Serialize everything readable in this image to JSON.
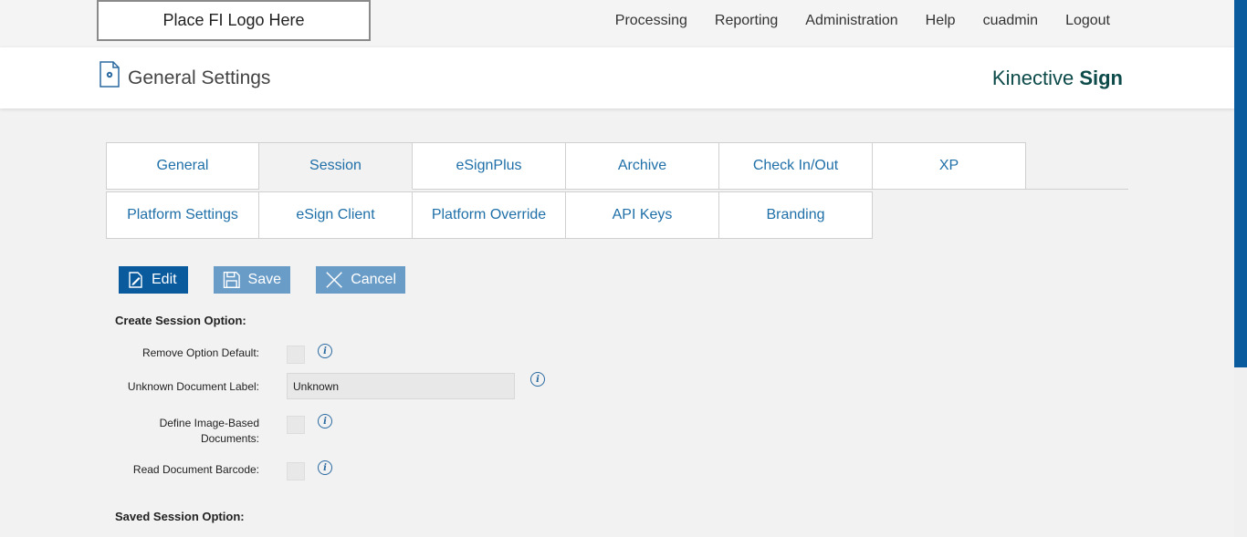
{
  "topbar": {
    "logo_placeholder": "Place FI Logo Here",
    "nav": [
      "Processing",
      "Reporting",
      "Administration",
      "Help",
      "cuadmin",
      "Logout"
    ]
  },
  "header": {
    "title": "General Settings",
    "brand_light": "Kinective",
    "brand_bold": "Sign"
  },
  "tabs": {
    "row1": [
      "General",
      "Session",
      "eSignPlus",
      "Archive",
      "Check In/Out",
      "XP"
    ],
    "row2": [
      "Platform Settings",
      "eSign Client",
      "Platform Override",
      "API Keys",
      "Branding"
    ],
    "active": "Session"
  },
  "toolbar": {
    "edit_label": "Edit",
    "save_label": "Save",
    "cancel_label": "Cancel"
  },
  "form": {
    "create_section_title": "Create Session Option:",
    "remove_option_default_label": "Remove Option Default:",
    "unknown_document_label_label": "Unknown Document Label:",
    "unknown_document_label_value": "Unknown",
    "define_image_based_label_line1": "Define Image-Based",
    "define_image_based_label_line2": "Documents:",
    "read_document_barcode_label": "Read Document Barcode:",
    "saved_section_title": "Saved Session Option:",
    "info_glyph": "i"
  },
  "colors": {
    "primary": "#0a5a9e",
    "primary_disabled": "#6a9cc8",
    "tab_text": "#1f6fa8",
    "brand": "#0d4a4a"
  }
}
